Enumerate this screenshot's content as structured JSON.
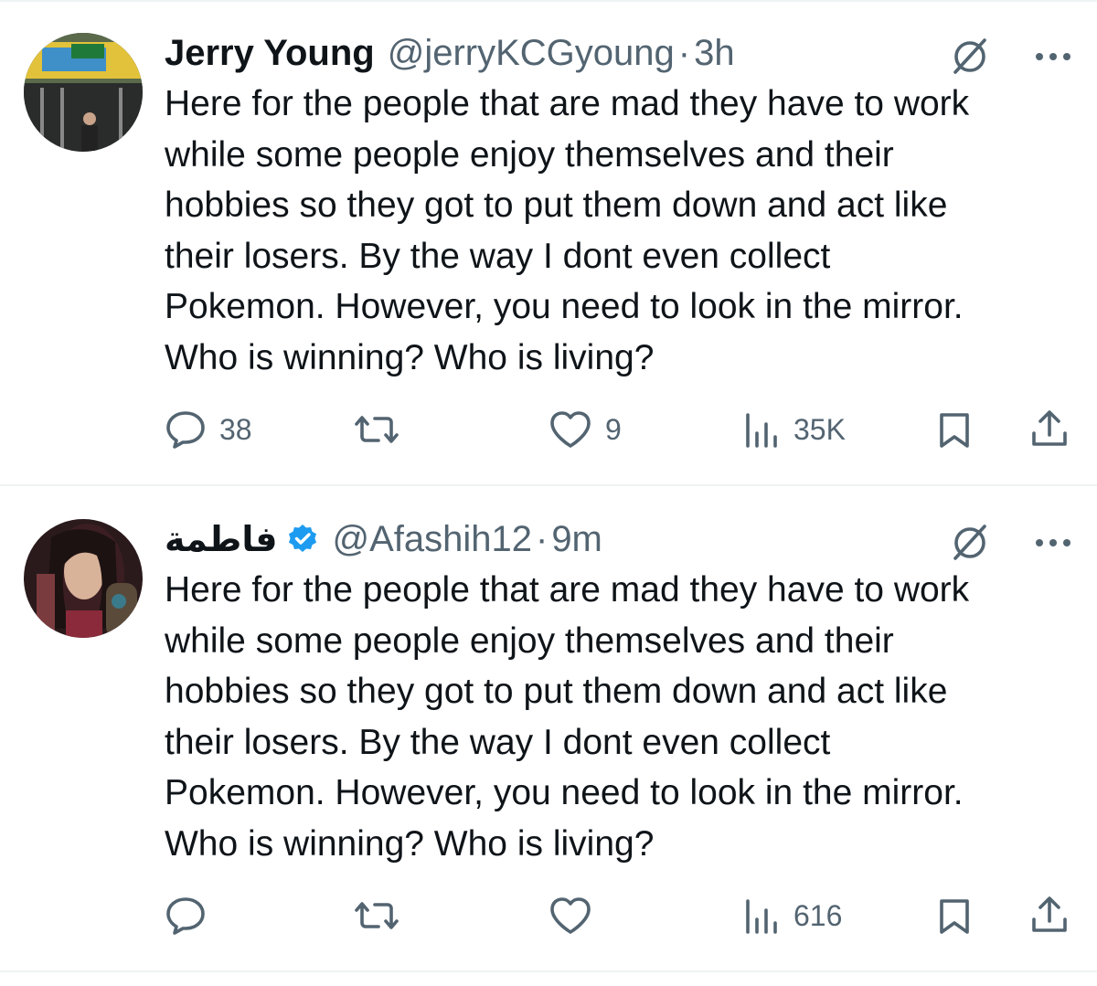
{
  "tweets": [
    {
      "author_name": "Jerry Young",
      "handle": "@jerryKCGyoung",
      "separator": "·",
      "time": "3h",
      "verified": false,
      "text": "Here for the people that are mad they have to work\nwhile some people enjoy themselves and their\nhobbies so they got to put them down and act like\ntheir losers. By the way I dont even collect\nPokemon. However, you need to look in the mirror.\nWho is winning? Who is living?",
      "replies": "38",
      "reposts": "",
      "likes": "9",
      "views": "35K",
      "avatar_icon": "person-street-photo-avatar"
    },
    {
      "author_name": "فاطمة",
      "handle": "@Afashih12",
      "separator": "·",
      "time": "9m",
      "verified": true,
      "text": "Here for the people that are mad they have to work\nwhile some people enjoy themselves and their\nhobbies so they got to put them down and act like\ntheir losers. By the way I dont even collect\nPokemon. However, you need to look in the mirror.\nWho is winning? Who is living?",
      "replies": "",
      "reposts": "",
      "likes": "",
      "views": "616",
      "avatar_icon": "woman-portrait-avatar"
    }
  ],
  "icons": {
    "no_grok": "grok-slash-icon",
    "more": "more-dots-icon",
    "reply": "reply-bubble-icon",
    "repost": "repost-icon",
    "like": "heart-icon",
    "views": "views-bar-chart-icon",
    "bookmark": "bookmark-icon",
    "share": "share-upload-icon",
    "verified": "verified-badge-icon"
  },
  "colors": {
    "text": "#0f1419",
    "secondary": "#536471",
    "verified": "#1d9bf0",
    "divider": "#eff3f4"
  }
}
